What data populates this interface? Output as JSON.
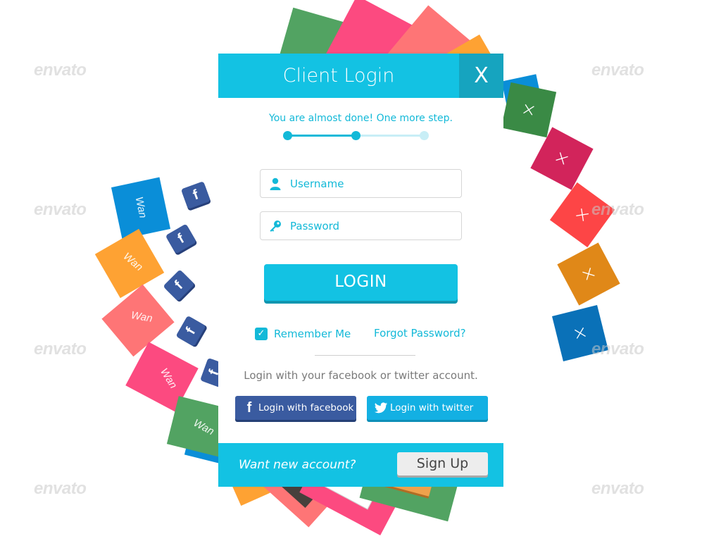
{
  "header": {
    "title": "Client Login",
    "close_label": "X"
  },
  "progress": {
    "message": "You are almost done! One more step.",
    "current_step": 2,
    "total_steps": 3,
    "colors": {
      "active": "#13b9d8",
      "pending": "#c8eef6"
    }
  },
  "form": {
    "username_placeholder": "Username",
    "username_value": "",
    "password_placeholder": "Password",
    "password_value": "",
    "login_label": "LOGIN",
    "remember_label": "Remember Me",
    "remember_checked": true,
    "forgot_label": "Forgot Password?"
  },
  "social": {
    "prompt": "Login with your facebook or twitter account.",
    "facebook_label": "Login with facebook",
    "twitter_label": "Login with twitter"
  },
  "footer": {
    "prompt": "Want new account?",
    "signup_label": "Sign Up"
  },
  "background": {
    "card_caption": "Wan",
    "close_glyph": "×",
    "fb_glyph": "f",
    "watermark": "envato"
  },
  "colors": {
    "accent": "#13c2e3",
    "accent_dark": "#16a4bf",
    "facebook": "#3a5ba0",
    "twitter": "#13b0e3"
  }
}
